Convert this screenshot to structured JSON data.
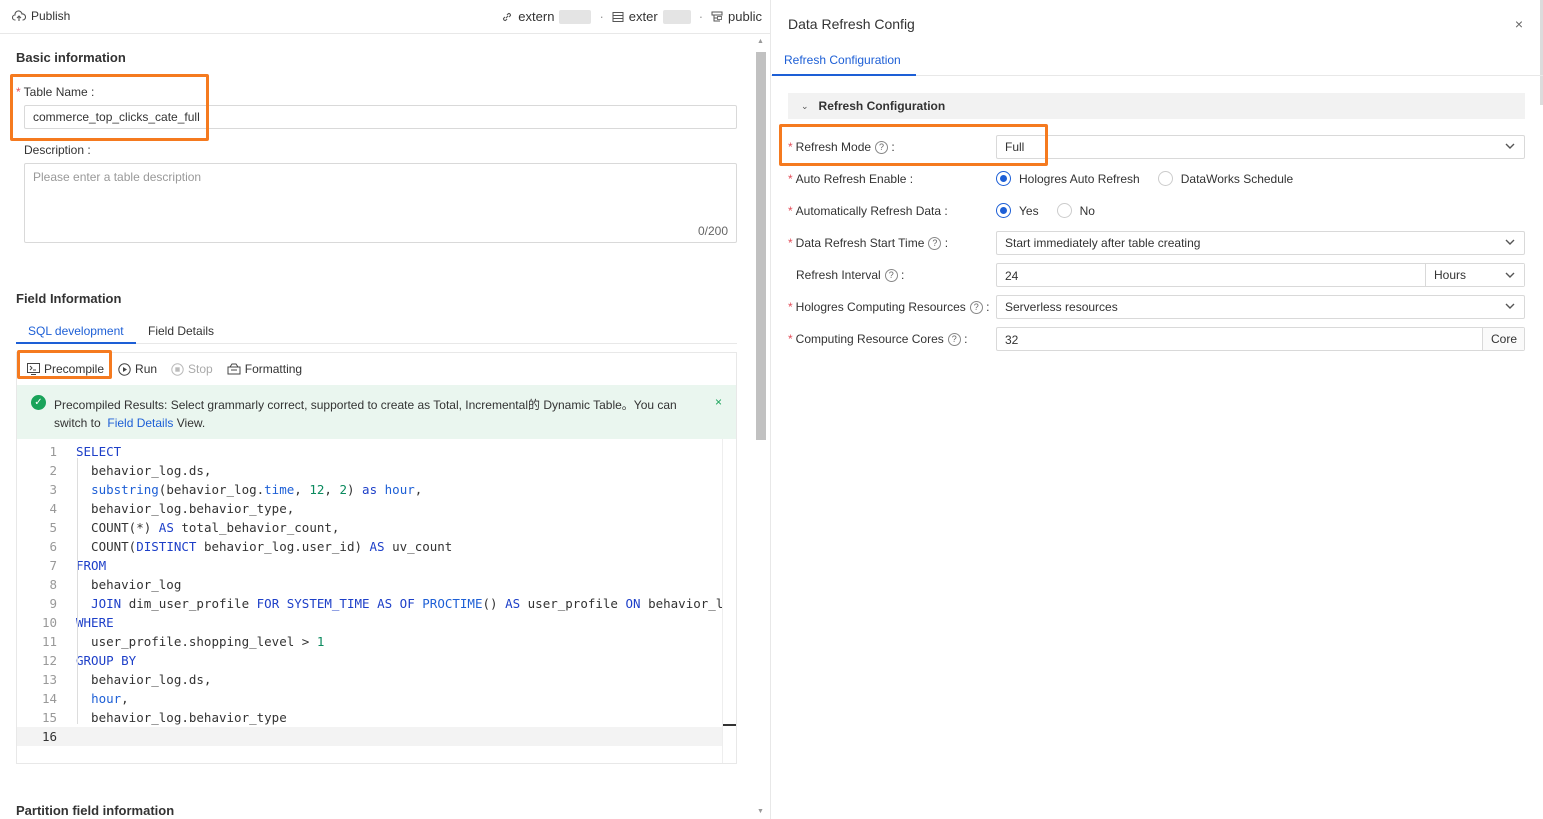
{
  "header": {
    "publish_label": "Publish",
    "breadcrumbs": [
      {
        "label": "extern",
        "icon": "link-icon"
      },
      {
        "label": "exter",
        "icon": "table-icon"
      },
      {
        "label": "public",
        "icon": "schema-icon"
      }
    ],
    "separator": "·"
  },
  "basic_info": {
    "title": "Basic information",
    "table_name_label": "Table Name :",
    "table_name_value": "commerce_top_clicks_cate_full",
    "description_label": "Description :",
    "description_placeholder": "Please enter a table description",
    "description_count": "0/200"
  },
  "field_info": {
    "title": "Field Information",
    "tabs": [
      {
        "label": "SQL development",
        "active": true
      },
      {
        "label": "Field Details",
        "active": false
      }
    ],
    "toolbar": {
      "precompile": "Precompile",
      "run": "Run",
      "stop": "Stop",
      "formatting": "Formatting"
    },
    "alert": {
      "message_before": "Precompiled Results: Select grammarly correct, supported to create as Total, Incremental的 Dynamic Table。You can switch to",
      "link": "Field Details",
      "message_after": "View.",
      "close": "×"
    },
    "sql_lines": [
      "SELECT",
      "  behavior_log.ds,",
      "  substring(behavior_log.time, 12, 2) as hour,",
      "  behavior_log.behavior_type,",
      "  COUNT(*) AS total_behavior_count,",
      "  COUNT(DISTINCT behavior_log.user_id) AS uv_count",
      "FROM",
      "  behavior_log",
      "  JOIN dim_user_profile FOR SYSTEM_TIME AS OF PROCTIME() AS user_profile ON behavior_l",
      "WHERE",
      "  user_profile.shopping_level > 1",
      "GROUP BY",
      "  behavior_log.ds,",
      "  hour,",
      "  behavior_log.behavior_type",
      ""
    ],
    "current_line": 16
  },
  "partition_info": {
    "title": "Partition field information"
  },
  "drawer": {
    "title": "Data Refresh Config",
    "close": "×",
    "tab": "Refresh Configuration",
    "section": "Refresh Configuration",
    "refresh_mode": {
      "label": "Refresh Mode",
      "value": "Full"
    },
    "auto_refresh_enable": {
      "label": "Auto Refresh Enable :",
      "options": [
        "Hologres Auto Refresh",
        "DataWorks Schedule"
      ],
      "selected": "Hologres Auto Refresh"
    },
    "automatically_refresh": {
      "label": "Automatically Refresh Data :",
      "options": [
        "Yes",
        "No"
      ],
      "selected": "Yes"
    },
    "start_time": {
      "label": "Data Refresh Start Time",
      "value": "Start immediately after table creating"
    },
    "interval": {
      "label": "Refresh Interval",
      "value": "24",
      "unit": "Hours"
    },
    "computing_resources": {
      "label": "Hologres Computing Resources",
      "value": "Serverless resources"
    },
    "cores": {
      "label": "Computing Resource Cores",
      "value": "32",
      "unit": "Core"
    }
  },
  "colors": {
    "accent": "#1d5fd6",
    "highlight": "#f57a1f",
    "success": "#1aa35a",
    "required": "#e34d59"
  }
}
